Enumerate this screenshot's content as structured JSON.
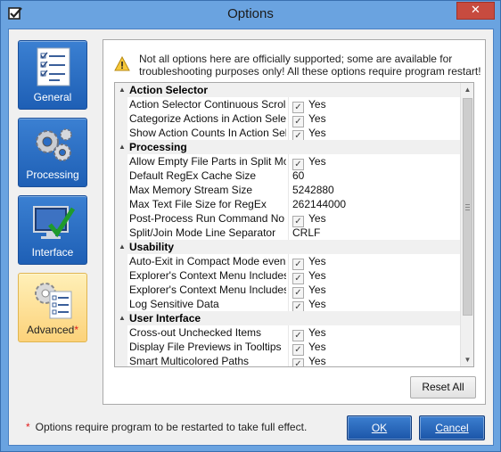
{
  "window": {
    "title": "Options",
    "close_label": "✕"
  },
  "nav": [
    {
      "label": "General",
      "icon": "checklist-icon",
      "active": false
    },
    {
      "label": "Processing",
      "icon": "gears-icon",
      "active": false
    },
    {
      "label": "Interface",
      "icon": "monitor-check-icon",
      "active": false
    },
    {
      "label": "Advanced",
      "icon": "gear-checklist-icon",
      "active": true,
      "marker": "*"
    }
  ],
  "notice": {
    "icon": "warning-icon",
    "text": "Not all options here are officially supported; some are available for troubleshooting purposes only! All these options require program restart!"
  },
  "categories": [
    {
      "name": "Action Selector",
      "options": [
        {
          "name": "Action Selector Continuous Scroll",
          "value": "Yes",
          "checkbox": true
        },
        {
          "name": "Categorize Actions in Action Selecto",
          "value": "Yes",
          "checkbox": true
        },
        {
          "name": "Show Action Counts In Action Select",
          "value": "Yes",
          "checkbox": true
        }
      ]
    },
    {
      "name": "Processing",
      "options": [
        {
          "name": "Allow Empty File Parts in Split Mode",
          "value": "Yes",
          "checkbox": true
        },
        {
          "name": "Default RegEx Cache Size",
          "value": "60",
          "checkbox": false
        },
        {
          "name": "Max Memory Stream Size",
          "value": "5242880",
          "checkbox": false
        },
        {
          "name": "Max Text File Size for RegEx",
          "value": "262144000",
          "checkbox": false
        },
        {
          "name": "Post-Process Run Command No Wi",
          "value": "Yes",
          "checkbox": true
        },
        {
          "name": "Split/Join Mode Line Separator",
          "value": "CRLF",
          "checkbox": false
        }
      ]
    },
    {
      "name": "Usability",
      "options": [
        {
          "name": "Auto-Exit in Compact Mode even if",
          "value": "Yes",
          "checkbox": true
        },
        {
          "name": "Explorer's Context Menu Includes F",
          "value": "Yes",
          "checkbox": true
        },
        {
          "name": "Explorer's Context Menu Includes F",
          "value": "Yes",
          "checkbox": true
        },
        {
          "name": "Log Sensitive Data",
          "value": "Yes",
          "checkbox": true
        }
      ]
    },
    {
      "name": "User Interface",
      "options": [
        {
          "name": "Cross-out Unchecked Items",
          "value": "Yes",
          "checkbox": true
        },
        {
          "name": "Display File Previews in Tooltips",
          "value": "Yes",
          "checkbox": true
        },
        {
          "name": "Smart Multicolored Paths",
          "value": "Yes",
          "checkbox": true
        }
      ]
    }
  ],
  "buttons": {
    "reset_all": "Reset All",
    "ok": "OK",
    "cancel": "Cancel"
  },
  "footnote": {
    "marker": "*",
    "text": "Options require program to be restarted to take full effect."
  },
  "colors": {
    "frame": "#6aa3e0",
    "nav_button": "#2a6cc4",
    "nav_active": "#fcd27a",
    "required_marker": "#e21b1b"
  }
}
